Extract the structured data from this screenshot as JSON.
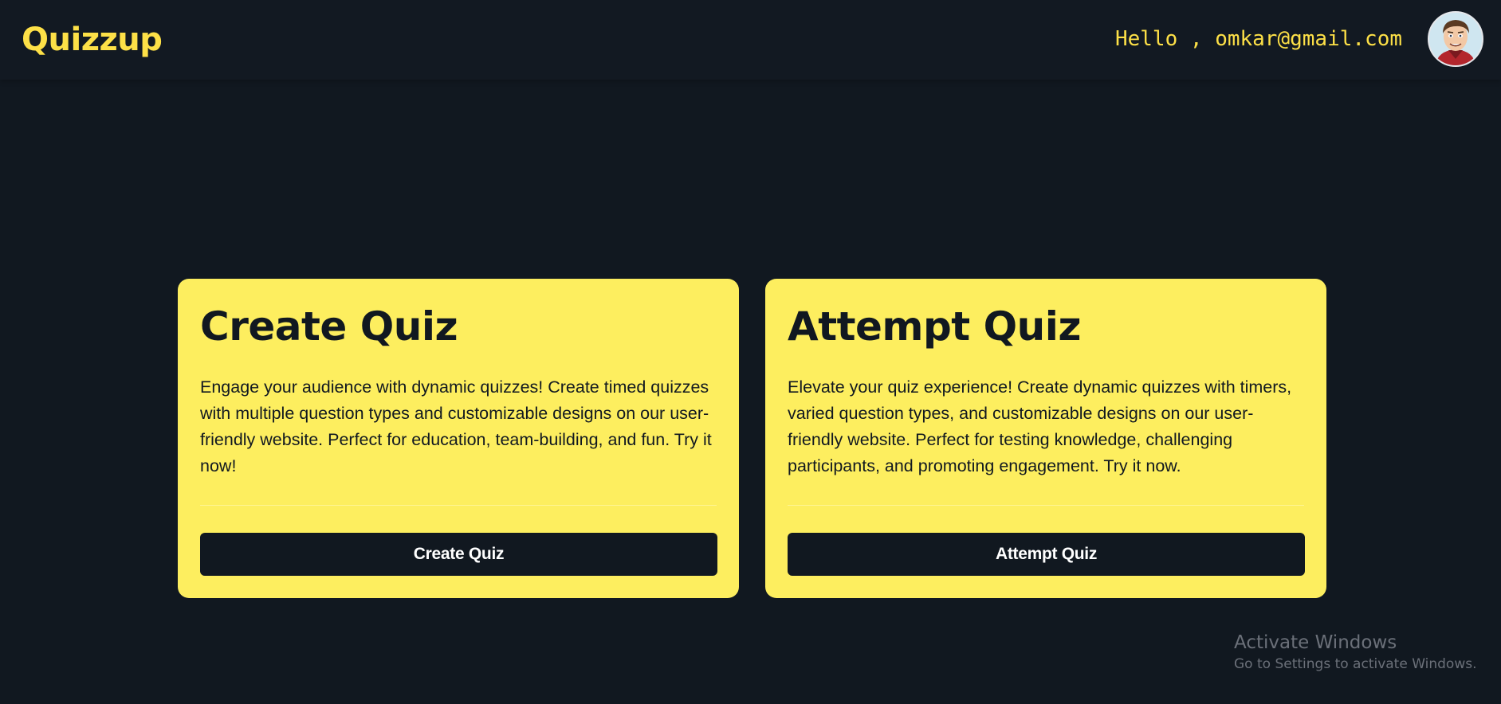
{
  "header": {
    "brand": "Quizzup",
    "greeting": "Hello , omkar@gmail.com",
    "avatar_icon": "user-avatar-icon"
  },
  "cards": [
    {
      "title": "Create Quiz",
      "description": "Engage your audience with dynamic quizzes! Create timed quizzes with multiple question types and customizable designs on our user-friendly website. Perfect for education, team-building, and fun. Try it now!",
      "button_label": "Create Quiz"
    },
    {
      "title": "Attempt Quiz",
      "description": "Elevate your quiz experience! Create dynamic quizzes with timers, varied question types, and customizable designs on our user-friendly website. Perfect for testing knowledge, challenging participants, and promoting engagement. Try it now.",
      "button_label": "Attempt Quiz"
    }
  ],
  "watermark": {
    "title": "Activate Windows",
    "subtitle": "Go to Settings to activate Windows."
  },
  "colors": {
    "background": "#111820",
    "accent": "#fde047",
    "card": "#fdee5f",
    "button": "#111820"
  }
}
